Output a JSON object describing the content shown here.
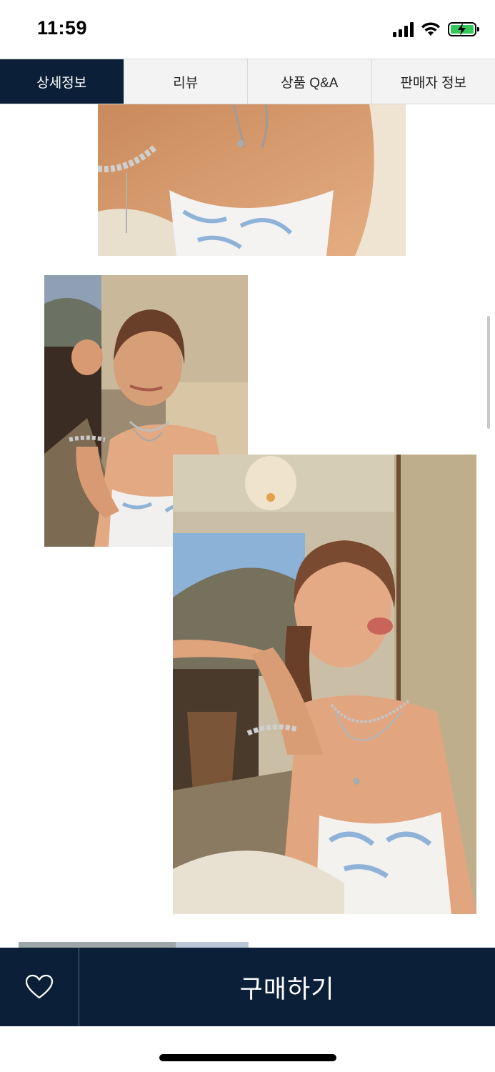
{
  "status_bar": {
    "time": "11:59"
  },
  "tabs": [
    {
      "label": "상세정보",
      "active": true
    },
    {
      "label": "리뷰",
      "active": false
    },
    {
      "label": "상품 Q&A",
      "active": false
    },
    {
      "label": "판매자 정보",
      "active": false
    }
  ],
  "purchase_bar": {
    "buy_label": "구매하기"
  },
  "colors": {
    "navy": "#0b2038",
    "battery": "#34c759"
  },
  "icons": [
    "signal-icon",
    "wifi-icon",
    "battery-icon",
    "heart-icon"
  ]
}
